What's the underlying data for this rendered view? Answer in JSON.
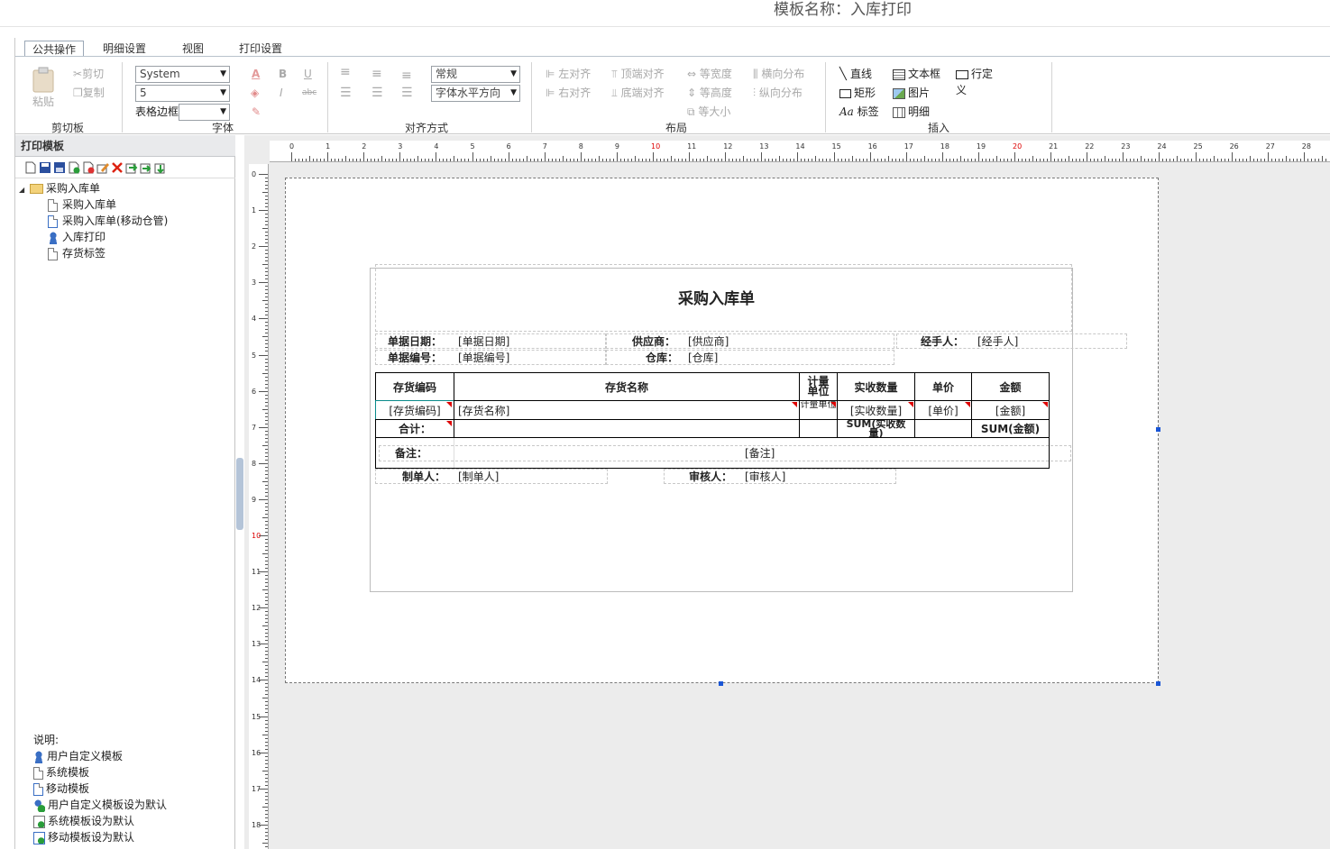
{
  "title": "模板名称：入库打印",
  "tabs": [
    "公共操作",
    "明细设置",
    "视图",
    "打印设置"
  ],
  "clipboard": {
    "paste": "粘贴",
    "cut": "剪切",
    "copy": "复制",
    "group": "剪切板"
  },
  "font": {
    "family": "System",
    "size": "5",
    "border_label": "表格边框",
    "border_value": "",
    "group": "字体",
    "style_value": "常规",
    "halign_value": "字体水平方向"
  },
  "align": {
    "group": "对齐方式"
  },
  "layout": {
    "left": "左对齐",
    "right": "右对齐",
    "top": "顶端对齐",
    "bottom": "底端对齐",
    "same_width": "等宽度",
    "same_height": "等高度",
    "same_size": "等大小",
    "h_dist": "横向分布",
    "v_dist": "纵向分布",
    "group": "布局"
  },
  "insert": {
    "line": "直线",
    "rect": "矩形",
    "label": "标签",
    "textbox": "文本框",
    "image": "图片",
    "detail": "明细",
    "custom": "行定义",
    "group": "插入"
  },
  "panel": {
    "header": "打印模板",
    "root": "采购入库单",
    "items": [
      "采购入库单",
      "采购入库单(移动仓管)",
      "入库打印",
      "存货标签"
    ]
  },
  "legend": {
    "title": "说明:",
    "items": [
      "用户自定义模板",
      "系统模板",
      "移动模板",
      "用户自定义模板设为默认",
      "系统模板设为默认",
      "移动模板设为默认"
    ]
  },
  "ruler_top": [
    "0",
    "1",
    "2",
    "3",
    "4",
    "5",
    "6",
    "7",
    "8",
    "9",
    "10",
    "11",
    "12",
    "13",
    "14",
    "15",
    "16",
    "17",
    "18",
    "19",
    "20",
    "21",
    "22",
    "23",
    "24",
    "25",
    "26",
    "27",
    "28"
  ],
  "ruler_left": [
    "0",
    "1",
    "2",
    "3",
    "4",
    "5",
    "6",
    "7",
    "8",
    "9",
    "10",
    "11",
    "12",
    "13",
    "14",
    "15",
    "16",
    "17",
    "18"
  ],
  "report": {
    "title": "采购入库单",
    "date_label": "单据日期：",
    "date_field": "[单据日期]",
    "supplier_label": "供应商：",
    "supplier_field": "[供应商]",
    "handler_label": "经手人：",
    "handler_field": "[经手人]",
    "no_label": "单据编号：",
    "no_field": "[单据编号]",
    "wh_label": "仓库：",
    "wh_field": "[仓库]",
    "headers": [
      "存货编码",
      "存货名称",
      "计量单位",
      "实收数量",
      "单价",
      "金额"
    ],
    "row": [
      "[存货编码]",
      "[存货名称]",
      "[计量单位]",
      "[实收数量]",
      "[单价]",
      "[金额]"
    ],
    "total_label": "合计：",
    "total_qty": "SUM(实收数量)",
    "total_amt": "SUM(金额)",
    "remark_label": "备注：",
    "remark_field": "[备注]",
    "maker_label": "制单人：",
    "maker_field": "[制单人]",
    "auditor_label": "审核人：",
    "auditor_field": "[审核人]"
  },
  "colors": {
    "accent": "#1a56d6",
    "marker": "#dd0000"
  }
}
